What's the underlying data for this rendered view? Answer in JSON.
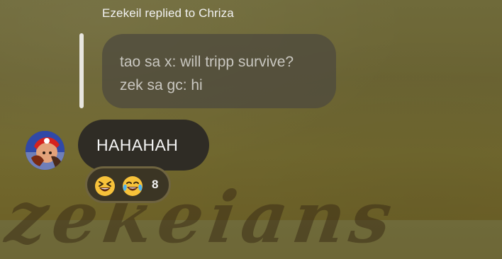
{
  "reply": {
    "header": "Ezekeil replied to Chriza",
    "quoted_lines": [
      "tao sa x: will tripp survive?",
      "zek sa gc: hi"
    ]
  },
  "message": {
    "text": "HAHAHAH",
    "avatar_icon": "user-avatar"
  },
  "reactions": {
    "emojis": [
      "grinning-squinting-face-icon",
      "face-with-tears-of-joy-icon"
    ],
    "count": "8"
  },
  "wallpaper": {
    "text": "zekeians"
  },
  "colors": {
    "background": "#6b6433",
    "quoted_bubble": "#4e4a3e",
    "message_bubble": "#2f2c25",
    "reaction_pill": "#3b3524",
    "reply_rail": "#e8e6df"
  }
}
